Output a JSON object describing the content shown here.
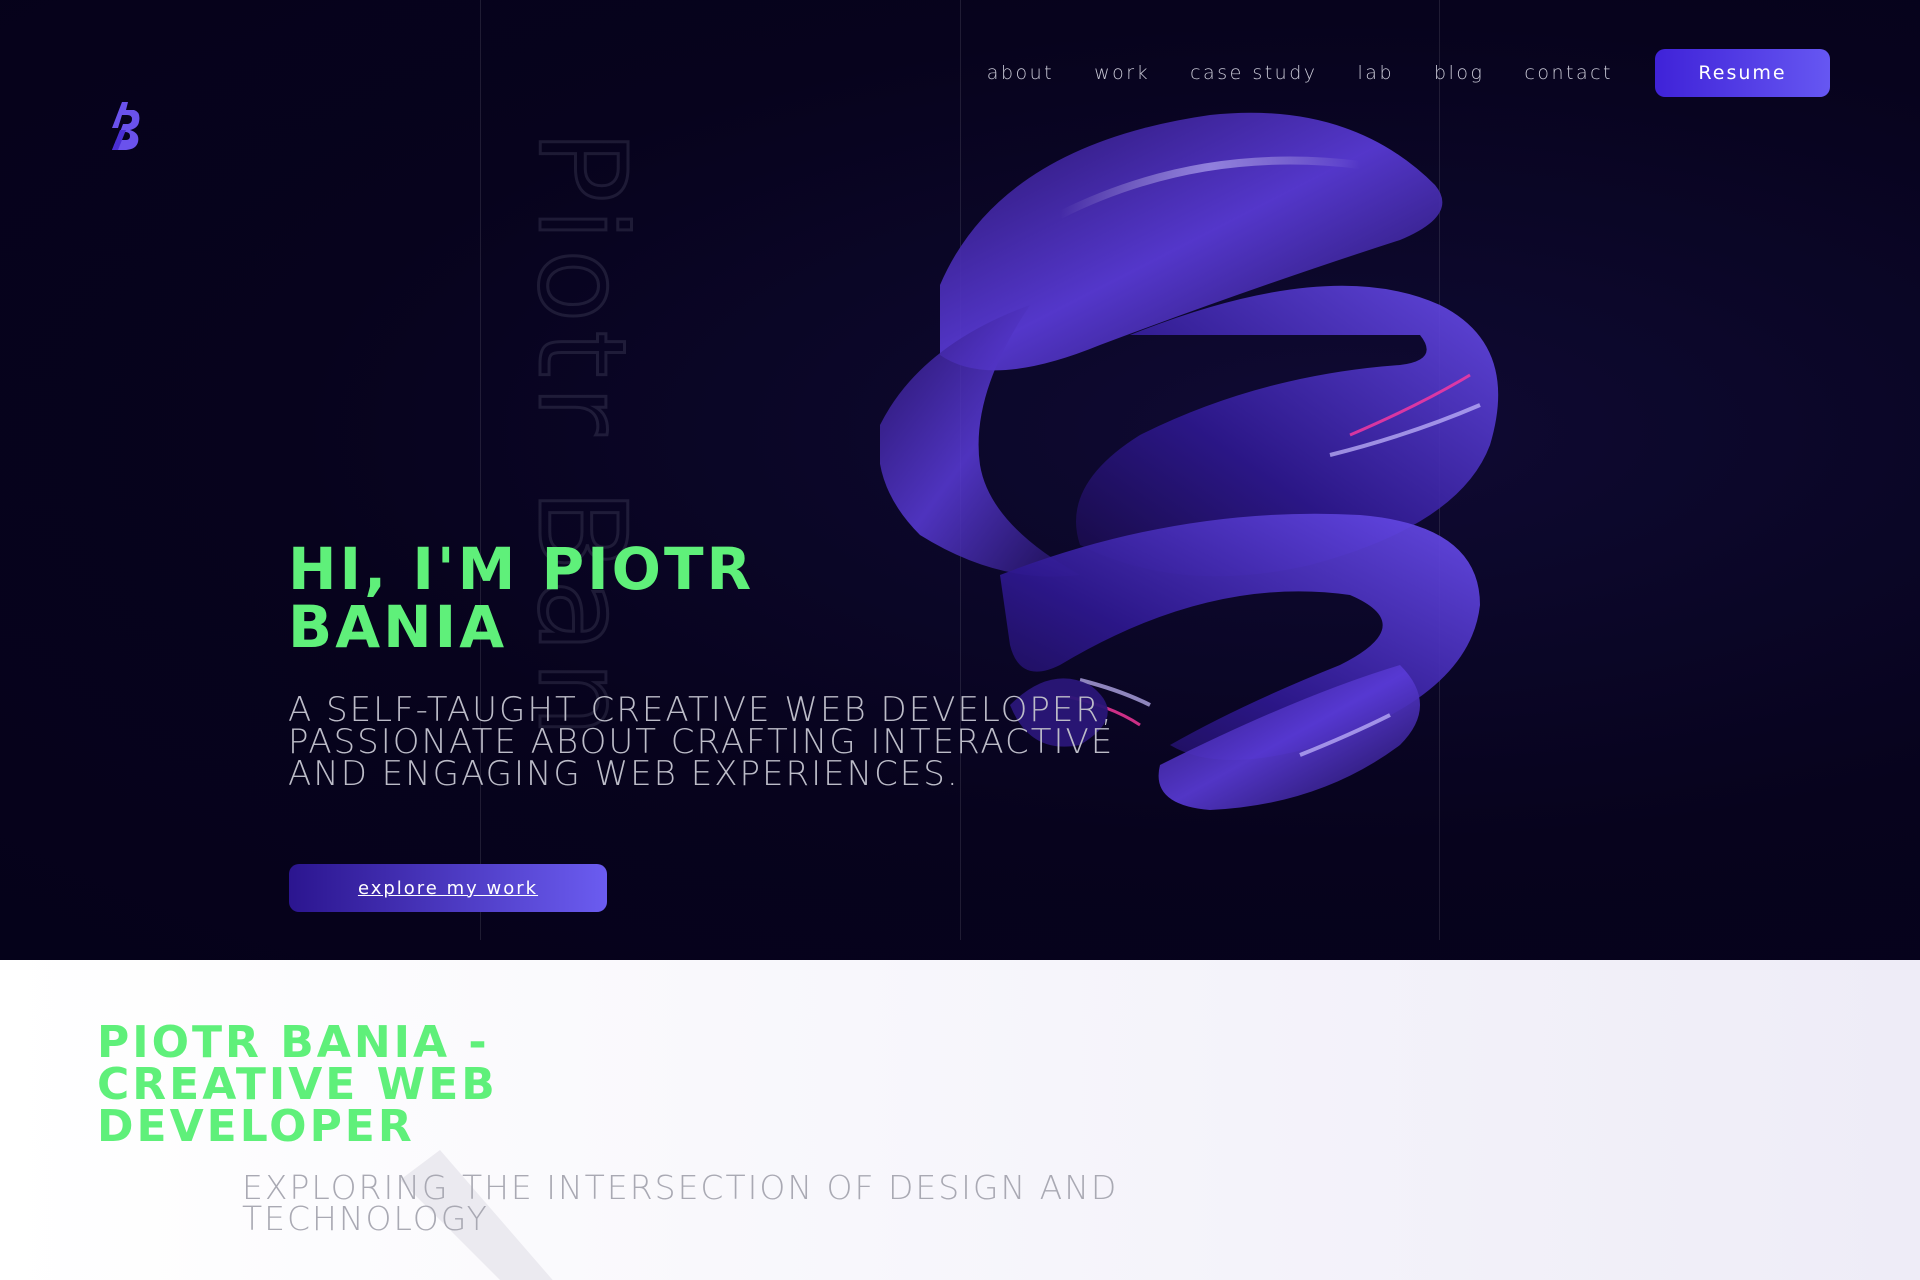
{
  "nav": {
    "items": [
      {
        "label": "about"
      },
      {
        "label": "work"
      },
      {
        "label": "case study"
      },
      {
        "label": "lab"
      },
      {
        "label": "blog"
      },
      {
        "label": "contact"
      }
    ],
    "resume_label": "Resume"
  },
  "hero": {
    "ghost_name": "Piotr Bania",
    "title": "HI, I'M PIOTR BANIA",
    "subtitle": "A SELF-TAUGHT CREATIVE WEB DEVELOPER, PASSIONATE ABOUT CRAFTING INTERACTIVE AND ENGAGING WEB EXPERIENCES.",
    "cta_label": "explore my work"
  },
  "about": {
    "title": "PIOTR BANIA - CREATIVE WEB DEVELOPER",
    "subtitle": "EXPLORING THE INTERSECTION OF DESIGN AND TECHNOLOGY"
  },
  "colors": {
    "accent_green": "#5ff07a",
    "accent_purple": "#5b48ee",
    "hero_bg": "#07031d"
  },
  "icons": {
    "logo": "pb-logo-icon"
  }
}
